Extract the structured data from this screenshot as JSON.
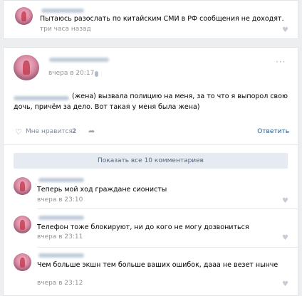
{
  "top_comment": {
    "text": "Пытаюсь разослать по китайским СМИ в РФ сообщения не доходят.",
    "time": "три часа назад"
  },
  "post": {
    "time": "вчера в 20:17",
    "text_line1": "(жена) вызвала полицию на меня, за то что я выпорол свою",
    "text_line2": "дочь, причём за дело. Вот такая у меня была жена)",
    "like_label": "Мне нравится",
    "like_count": "2",
    "reply_label": "Ответить",
    "show_all_label": "Показать все 10 комментариев"
  },
  "comments": [
    {
      "text": "Теперь мой ход граждане сионисты",
      "time": "вчера в 23:10"
    },
    {
      "text": "Телефон тоже блокируют, ни до кого не могу дозвониться",
      "time": "вчера в 23:11"
    },
    {
      "text": "Чем больше экшн тем больше ваших ошибок, дааа не везет нынче",
      "time": "вчера в 23:12"
    }
  ],
  "icons": {
    "heart": "heart-icon",
    "more": "more-dots-icon",
    "mic": "microphone-icon",
    "share": "share-icon"
  }
}
